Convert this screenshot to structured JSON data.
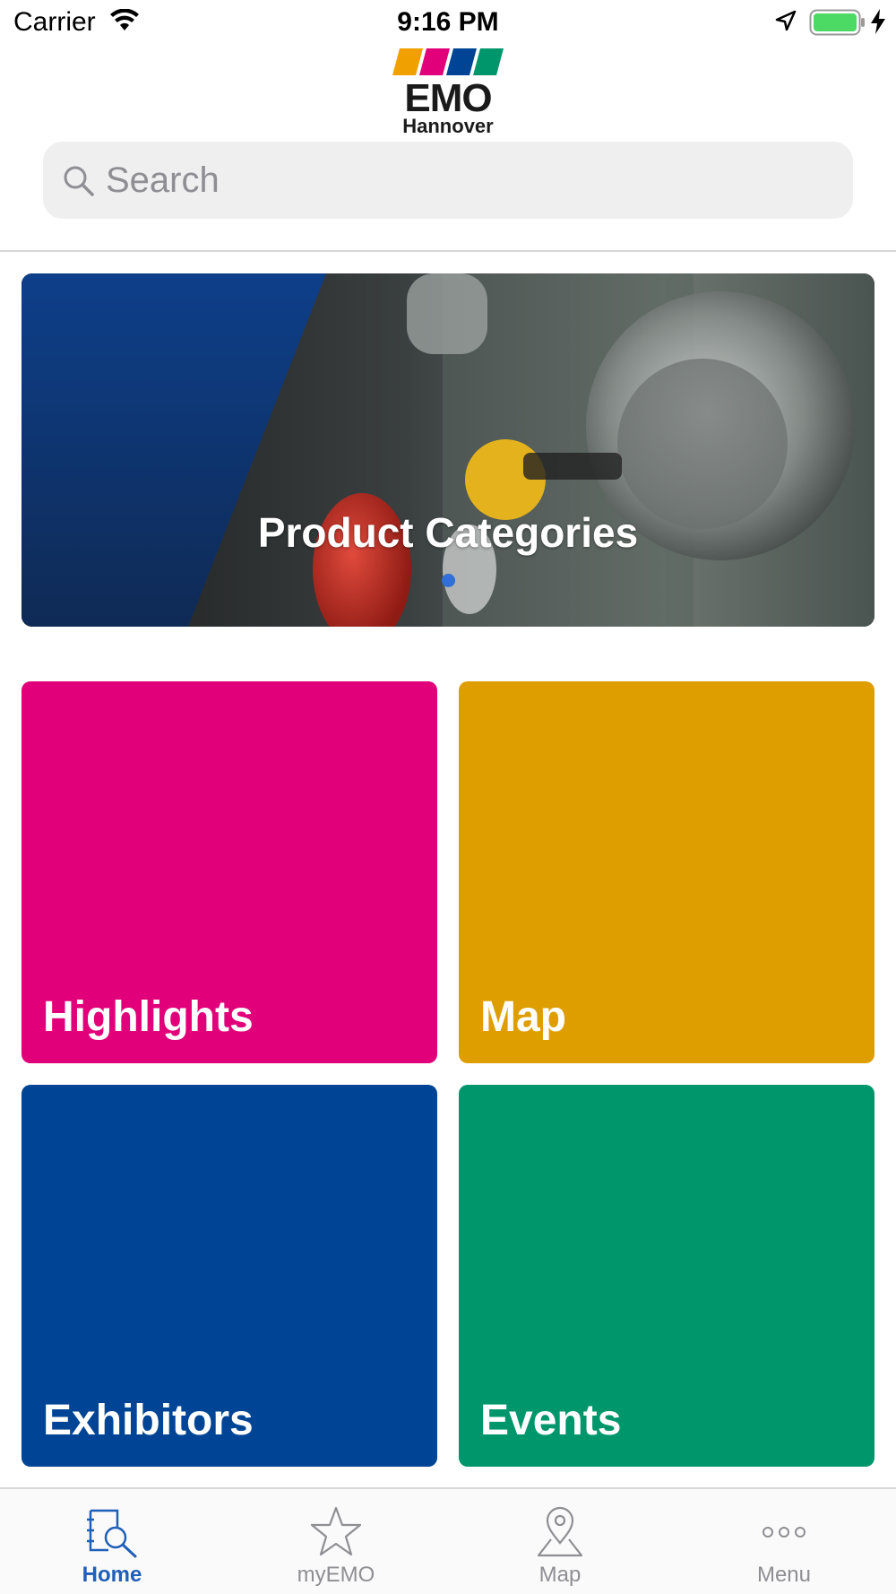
{
  "status_bar": {
    "carrier": "Carrier",
    "time": "9:16 PM",
    "battery_color": "#4cd964"
  },
  "logo": {
    "word": "EMO",
    "sub": "Hannover",
    "stripe_colors": [
      "#f0a000",
      "#e2007a",
      "#004595",
      "#00966b"
    ]
  },
  "search": {
    "placeholder": "Search"
  },
  "banner": {
    "title": "Product Categories",
    "page_indicator_color": "#2f6fd6"
  },
  "tiles": [
    {
      "label": "Highlights",
      "color": "#e2007a"
    },
    {
      "label": "Map",
      "color": "#df9e00"
    },
    {
      "label": "Exhibitors",
      "color": "#004595"
    },
    {
      "label": "Events",
      "color": "#00966b"
    }
  ],
  "tab_bar": {
    "accent": "#1f5fb8",
    "items": [
      {
        "label": "Home",
        "icon": "home-search-icon",
        "active": true
      },
      {
        "label": "myEMO",
        "icon": "star-icon",
        "active": false
      },
      {
        "label": "Map",
        "icon": "map-pin-icon",
        "active": false
      },
      {
        "label": "Menu",
        "icon": "more-icon",
        "active": false
      }
    ]
  }
}
